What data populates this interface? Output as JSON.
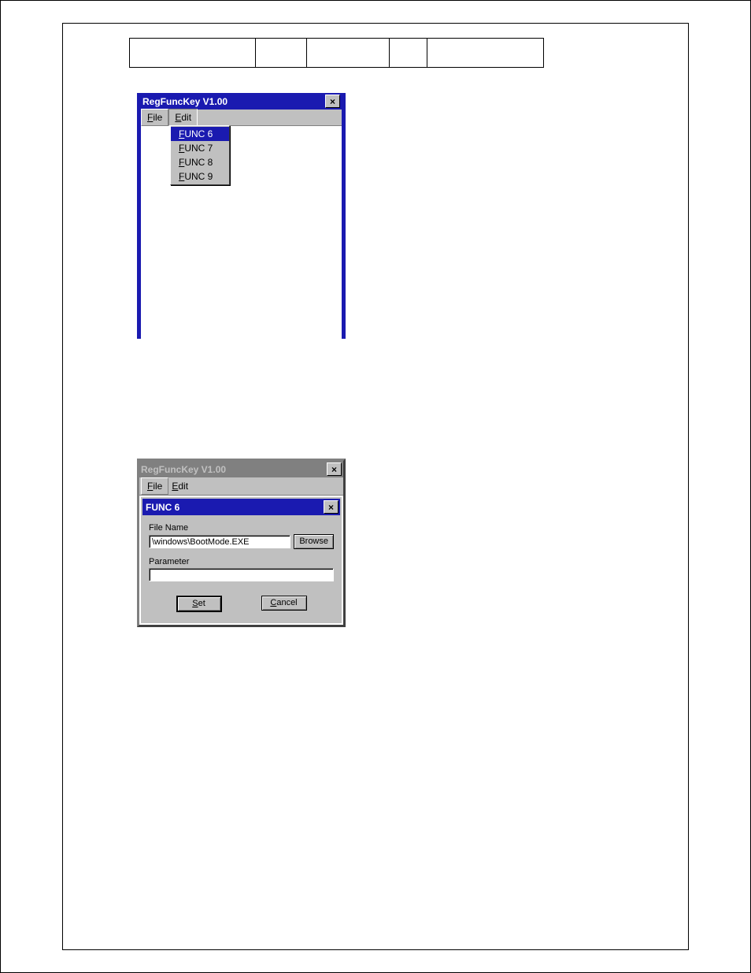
{
  "window1": {
    "title": "RegFuncKey  V1.00",
    "close_glyph": "×",
    "menubar": {
      "file": "File",
      "edit": "Edit"
    },
    "dropdown": {
      "items": [
        "FUNC 6",
        "FUNC 7",
        "FUNC 8",
        "FUNC 9"
      ],
      "highlighted_index": 0
    }
  },
  "window2": {
    "outer_title": "RegFuncKey  V1.00",
    "close_glyph": "×",
    "menubar": {
      "file": "File",
      "edit": "Edit"
    },
    "inner_title": "FUNC 6",
    "filename_label": "File Name",
    "filename_value": "\\windows\\BootMode.EXE",
    "browse_label": "Browse",
    "parameter_label": "Parameter",
    "parameter_value": "",
    "set_label": "Set",
    "cancel_label": "Cancel"
  }
}
